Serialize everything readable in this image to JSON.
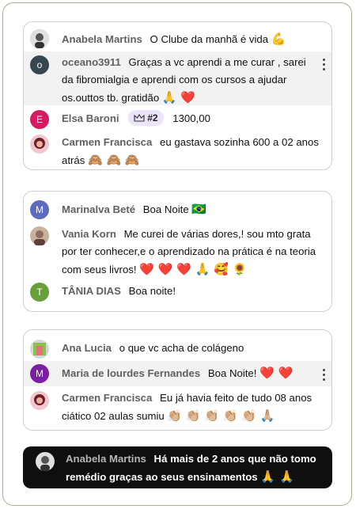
{
  "cards": [
    {
      "messages": [
        {
          "author": "Anabela Martins",
          "text": "O Clube da manhã é vida",
          "emoji": "💪",
          "avatar": "photo"
        },
        {
          "author": "oceano3911",
          "text": "Graças a vc aprendi a me curar , sarei da fibromialgia e aprendi com os cursos a ajudar os.outtos tb. gratidão",
          "emoji": "🙏 ❤️",
          "avatar_letter": "o",
          "avatar_color": "#37474f"
        },
        {
          "author": "Elsa Baroni",
          "badge": "#2",
          "text": "1300,00",
          "avatar_letter": "E",
          "avatar_color": "#d81b60"
        },
        {
          "author": "Carmen Francisca",
          "text": "eu gastava sozinha 600 a 02 anos atrás",
          "emoji": "🙈 🙈 🙈",
          "avatar": "photo"
        }
      ]
    },
    {
      "messages": [
        {
          "author": "Marinalva Beté",
          "text": "Boa Noite",
          "emoji": "🇧🇷",
          "avatar_letter": "M",
          "avatar_color": "#5c6bc0"
        },
        {
          "author": "Vania Korn",
          "text": "Me curei de várias dores,! sou mto grata por ter conhecer,e o aprendizado na prática é na teoria com seus livros!",
          "emoji": "❤️ ❤️ ❤️ 🙏 🥰 🌻",
          "avatar": "photo"
        },
        {
          "author": "TÂNIA DIAS",
          "text": "Boa noite!",
          "avatar_letter": "T",
          "avatar_color": "#689f38"
        }
      ]
    },
    {
      "messages": [
        {
          "author": "Ana Lucia",
          "text": "o que vc acha de colágeno",
          "avatar": "photo"
        },
        {
          "author": "Maria de lourdes Fernandes",
          "text": "Boa Noite!",
          "emoji": "❤️ ❤️",
          "avatar_letter": "M",
          "avatar_color": "#7b1fa2"
        },
        {
          "author": "Carmen Francisca",
          "text": "Eu já havia feito de tudo 08 anos ciático 02 aulas sumiu",
          "emoji": "👏🏼 👏🏼 👏🏼 👏🏼 👏🏼 🙏🏼",
          "avatar": "photo"
        }
      ]
    }
  ],
  "highlight": {
    "author": "Anabela Martins",
    "text": "Há mais de 2 anos que não tomo remédio graças ao seus ensinamentos",
    "emoji": "🙏 🙏",
    "avatar": "photo"
  }
}
